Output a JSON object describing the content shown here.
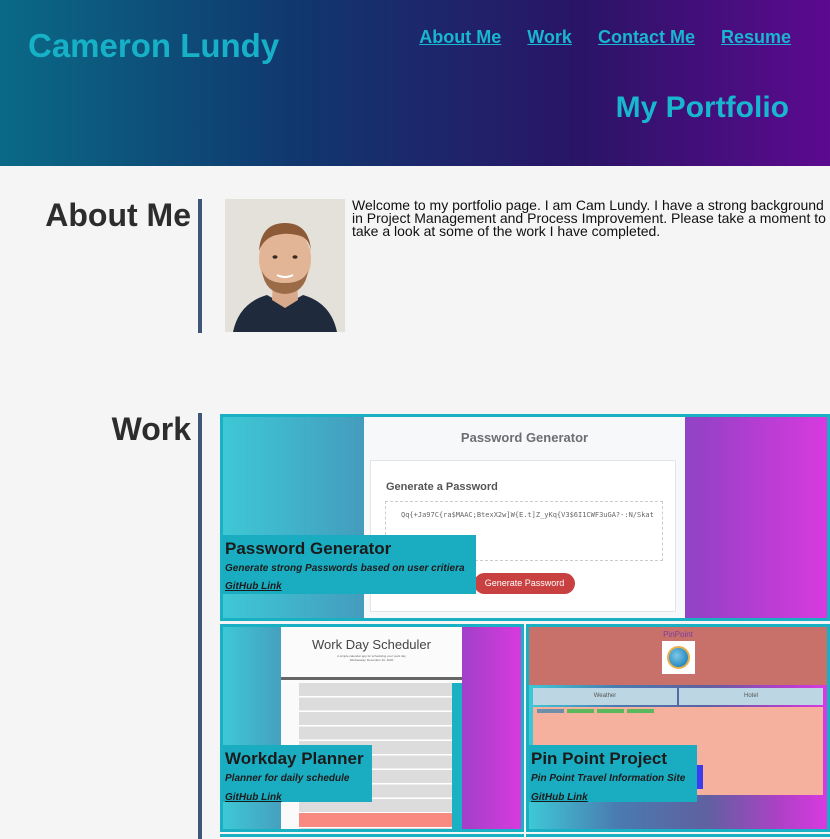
{
  "header": {
    "name": "Cameron Lundy",
    "nav": [
      "About Me",
      "Work",
      "Contact Me",
      "Resume"
    ],
    "portfolio_title": "My Portfolio"
  },
  "about": {
    "title": "About Me",
    "text": "Welcome to my portfolio page. I am Cam Lundy. I have a strong background in Project Management and Process Improvement. Please take a moment to take a look at some of the work I have completed."
  },
  "work": {
    "title": "Work",
    "projects": [
      {
        "name": "Password Generator",
        "description": "Generate strong Passwords based on user critiera",
        "link": "GitHub Link",
        "screenshot": {
          "heading": "Password Generator",
          "card_title": "Generate a Password",
          "password": "Qq{+Ja97C{ra$MAAC;BtexX2w]W{E.t]Z_yKq{V3$6I1CWF3uGA?-:N/Skat",
          "button": "Generate Password"
        }
      },
      {
        "name": "Workday Planner",
        "description": "Planner for daily schedule",
        "link": "GitHub Link",
        "screenshot": {
          "heading": "Work Day Scheduler",
          "subtitle": "A simple calendar app for scheduling your work day",
          "date": "Wednesday, December 16, 2020"
        }
      },
      {
        "name": "Pin Point Project",
        "description": "Pin Point Travel Information Site",
        "link": "GitHub Link",
        "screenshot": {
          "heading": "PinPoint",
          "tab_weather": "Weather",
          "tab_hotel": "Hotel"
        }
      }
    ]
  },
  "colors": {
    "accent": "#19b0c4",
    "header_gradient_start": "#0a6a86",
    "header_gradient_end": "#5c0a8f",
    "divider": "#3e5678"
  }
}
